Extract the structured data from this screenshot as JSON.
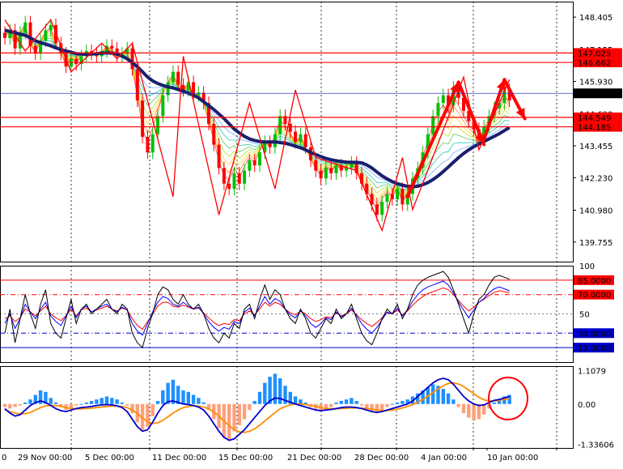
{
  "chart_data": {
    "type": "candlestick",
    "colors": {
      "bull": "#00c000",
      "bear": "#ff0000",
      "ma_main": "#1a1f6e",
      "resistance": "#ff0000",
      "current_line": "#2f3fc0",
      "osc_fast": "#000000",
      "osc_mid": "#0000ff",
      "osc_slow": "#ff0000",
      "hist_pos": "#1e90ff",
      "hist_neg": "#ffa07a",
      "macd_line": "#0000cd",
      "signal_line": "#ff8c00",
      "arrow": "#ff0000"
    },
    "x_axis": {
      "tick_labels": [
        "29 Nov 00:00",
        "5 Dec 00:00",
        "11 Dec 00:00",
        "15 Dec 00:00",
        "21 Dec 00:00",
        "28 Dec 00:00",
        "4 Jan 00:00",
        "10 Jan 00:00"
      ],
      "left_edge_label": "0"
    },
    "price_panel": {
      "ylim": [
        139.0,
        149.0
      ],
      "tick_labels": [
        "148.405",
        "147.155",
        "145.930",
        "144.690",
        "143.455",
        "142.230",
        "140.980",
        "139.755"
      ],
      "tick_values": [
        148.405,
        147.155,
        145.93,
        144.69,
        143.455,
        142.23,
        140.98,
        139.755
      ],
      "levels": [
        {
          "label": "147.025",
          "value": 147.025,
          "color": "#ff0000",
          "text_color": "#ffffff"
        },
        {
          "label": "146.662",
          "value": 146.662,
          "color": "#ff0000",
          "text_color": "#ffffff"
        },
        {
          "label": "144.549",
          "value": 144.549,
          "color": "#ff0000",
          "text_color": "#ffffff"
        },
        {
          "label": "144.185",
          "value": 144.185,
          "color": "#ff0000",
          "text_color": "#ffffff"
        }
      ],
      "current_price": {
        "label": "145.472",
        "value": 145.472
      },
      "close": [
        147.6,
        147.9,
        147.2,
        147.8,
        148.2,
        147.3,
        147.0,
        147.5,
        147.9,
        148.1,
        147.4,
        147.0,
        146.5,
        146.8,
        146.6,
        146.9,
        147.1,
        147.0,
        146.9,
        147.1,
        147.3,
        147.2,
        146.9,
        147.0,
        147.2,
        146.4,
        145.2,
        143.8,
        143.2,
        143.9,
        144.6,
        145.4,
        145.9,
        146.3,
        145.8,
        145.6,
        145.9,
        145.4,
        145.5,
        145.1,
        144.3,
        143.5,
        142.6,
        142.0,
        141.8,
        142.4,
        142.0,
        142.5,
        142.9,
        142.7,
        143.2,
        143.6,
        143.4,
        143.9,
        144.6,
        144.3,
        144.0,
        143.6,
        143.9,
        143.4,
        142.9,
        142.5,
        142.2,
        142.6,
        142.4,
        142.7,
        142.5,
        142.6,
        142.8,
        142.4,
        142.0,
        141.6,
        141.2,
        140.8,
        141.3,
        141.6,
        141.4,
        141.8,
        141.2,
        141.6,
        142.2,
        142.6,
        143.2,
        143.9,
        144.6,
        145.1,
        145.4,
        145.0,
        145.7,
        145.3,
        144.8,
        144.4,
        144.1,
        143.7,
        144.2,
        144.6,
        144.9,
        145.1,
        145.6,
        145.2
      ],
      "ma_main": [
        147.9,
        147.85,
        147.8,
        147.75,
        147.7,
        147.6,
        147.5,
        147.42,
        147.36,
        147.3,
        147.22,
        147.16,
        147.1,
        147.05,
        147.0,
        146.98,
        146.97,
        146.98,
        147.0,
        147.02,
        147.03,
        147.02,
        146.98,
        146.9,
        146.8,
        146.65,
        146.5,
        146.3,
        146.1,
        145.95,
        145.85,
        145.78,
        145.72,
        145.68,
        145.62,
        145.55,
        145.48,
        145.4,
        145.3,
        145.15,
        145.0,
        144.85,
        144.68,
        144.5,
        144.3,
        144.1,
        143.95,
        143.82,
        143.72,
        143.66,
        143.62,
        143.6,
        143.6,
        143.6,
        143.58,
        143.55,
        143.5,
        143.44,
        143.38,
        143.3,
        143.2,
        143.12,
        143.04,
        142.97,
        142.92,
        142.88,
        142.85,
        142.83,
        142.82,
        142.82,
        142.8,
        142.72,
        142.6,
        142.45,
        142.3,
        142.18,
        142.08,
        142.0,
        141.94,
        141.9,
        141.88,
        141.9,
        141.96,
        142.04,
        142.16,
        142.3,
        142.46,
        142.64,
        142.82,
        143.0,
        143.16,
        143.3,
        143.42,
        143.52,
        143.62,
        143.72,
        143.82,
        143.92,
        144.04,
        144.16
      ]
    },
    "zigzag": {
      "points": [
        [
          0,
          148.3
        ],
        [
          4,
          147.1
        ],
        [
          9,
          148.3
        ],
        [
          13,
          146.3
        ],
        [
          19,
          147.4
        ],
        [
          22,
          146.8
        ],
        [
          25,
          147.4
        ],
        [
          33,
          141.5
        ],
        [
          35,
          146.9
        ],
        [
          42,
          140.8
        ],
        [
          48,
          145.1
        ],
        [
          53,
          141.8
        ],
        [
          57,
          145.6
        ],
        [
          61,
          143.0
        ],
        [
          69,
          142.5
        ],
        [
          74,
          140.2
        ],
        [
          78,
          143.0
        ],
        [
          80,
          141.0
        ],
        [
          90,
          146.1
        ],
        [
          93,
          143.3
        ],
        [
          99,
          146.0
        ]
      ]
    },
    "oscillator_panel": {
      "ylim": [
        0,
        100
      ],
      "tick_labels": [
        "100",
        "50"
      ],
      "tick_values": [
        100,
        50
      ],
      "levels": [
        {
          "label": "85.0000",
          "value": 85,
          "color": "#ff0000",
          "style": "solid"
        },
        {
          "label": "70.0000",
          "value": 70,
          "color": "#ff0000",
          "style": "dashdot"
        },
        {
          "label": "30.0000",
          "value": 30,
          "color": "#0000cd",
          "style": "dashdot"
        },
        {
          "label": "15.0000",
          "value": 15,
          "color": "#0000cd",
          "style": "solid"
        }
      ],
      "fast": [
        30,
        55,
        20,
        45,
        70,
        50,
        35,
        60,
        75,
        40,
        30,
        25,
        45,
        65,
        40,
        55,
        60,
        50,
        55,
        60,
        65,
        55,
        50,
        60,
        55,
        30,
        20,
        15,
        35,
        50,
        70,
        78,
        75,
        65,
        60,
        70,
        60,
        55,
        60,
        50,
        35,
        25,
        20,
        30,
        25,
        40,
        35,
        55,
        60,
        45,
        65,
        80,
        65,
        75,
        70,
        55,
        45,
        40,
        55,
        45,
        30,
        25,
        35,
        45,
        40,
        55,
        45,
        50,
        60,
        45,
        30,
        22,
        18,
        30,
        45,
        55,
        50,
        60,
        45,
        55,
        70,
        80,
        85,
        88,
        90,
        92,
        94,
        88,
        75,
        60,
        45,
        30,
        50,
        65,
        70,
        80,
        88,
        90,
        88,
        86
      ],
      "mid": [
        40,
        50,
        35,
        45,
        60,
        52,
        45,
        55,
        62,
        48,
        42,
        38,
        48,
        58,
        46,
        55,
        58,
        52,
        55,
        58,
        60,
        55,
        52,
        57,
        54,
        40,
        32,
        28,
        40,
        52,
        62,
        68,
        66,
        60,
        58,
        62,
        58,
        55,
        57,
        50,
        42,
        36,
        32,
        36,
        34,
        42,
        40,
        52,
        56,
        48,
        58,
        68,
        60,
        66,
        63,
        55,
        49,
        46,
        53,
        48,
        40,
        36,
        40,
        46,
        44,
        52,
        47,
        50,
        56,
        48,
        40,
        34,
        30,
        36,
        44,
        52,
        50,
        56,
        48,
        54,
        63,
        70,
        75,
        78,
        80,
        82,
        84,
        80,
        72,
        62,
        54,
        46,
        54,
        62,
        66,
        72,
        76,
        78,
        76,
        74
      ],
      "slow": [
        45,
        48,
        42,
        46,
        55,
        52,
        48,
        53,
        58,
        50,
        46,
        43,
        48,
        55,
        48,
        54,
        56,
        52,
        54,
        56,
        58,
        55,
        53,
        56,
        54,
        45,
        38,
        34,
        42,
        50,
        58,
        62,
        62,
        58,
        57,
        59,
        57,
        55,
        56,
        51,
        46,
        41,
        38,
        40,
        39,
        44,
        43,
        50,
        53,
        49,
        55,
        62,
        58,
        62,
        60,
        55,
        51,
        49,
        53,
        50,
        45,
        42,
        44,
        47,
        46,
        51,
        48,
        50,
        54,
        49,
        44,
        40,
        37,
        41,
        46,
        51,
        50,
        54,
        49,
        53,
        59,
        64,
        68,
        71,
        73,
        75,
        77,
        75,
        70,
        64,
        58,
        53,
        57,
        62,
        65,
        69,
        72,
        74,
        73,
        72
      ]
    },
    "macd_panel": {
      "ylim": [
        -1.45,
        1.25
      ],
      "tick_labels": [
        "1.1079",
        "0.00",
        "-1.33606"
      ],
      "tick_values": [
        1.1079,
        0.0,
        -1.33606
      ],
      "histogram": [
        -0.1,
        -0.15,
        -0.1,
        -0.05,
        0.05,
        0.15,
        0.3,
        0.45,
        0.4,
        0.2,
        0.05,
        -0.1,
        -0.2,
        -0.15,
        -0.05,
        0.0,
        0.05,
        0.1,
        0.15,
        0.2,
        0.25,
        0.2,
        0.15,
        0.05,
        -0.05,
        -0.3,
        -0.6,
        -0.85,
        -0.75,
        -0.4,
        0.1,
        0.45,
        0.7,
        0.8,
        0.6,
        0.45,
        0.4,
        0.3,
        0.2,
        0.05,
        -0.2,
        -0.5,
        -0.8,
        -1.1,
        -1.2,
        -0.9,
        -0.7,
        -0.5,
        -0.2,
        0.1,
        0.4,
        0.7,
        0.9,
        1.0,
        0.85,
        0.6,
        0.4,
        0.25,
        0.15,
        0.05,
        -0.1,
        -0.2,
        -0.25,
        -0.15,
        -0.1,
        0.05,
        0.1,
        0.15,
        0.2,
        0.1,
        -0.05,
        -0.15,
        -0.25,
        -0.3,
        -0.2,
        -0.1,
        0.0,
        0.05,
        0.1,
        0.15,
        0.25,
        0.35,
        0.45,
        0.55,
        0.65,
        0.6,
        0.5,
        0.35,
        0.15,
        -0.1,
        -0.3,
        -0.45,
        -0.55,
        -0.5,
        -0.35,
        -0.15,
        0.05,
        0.15,
        0.25,
        0.3
      ],
      "macd": [
        -0.15,
        -0.3,
        -0.4,
        -0.35,
        -0.2,
        -0.05,
        0.05,
        0.1,
        0.05,
        -0.05,
        -0.15,
        -0.22,
        -0.25,
        -0.2,
        -0.15,
        -0.12,
        -0.1,
        -0.08,
        -0.05,
        -0.03,
        -0.02,
        -0.03,
        -0.06,
        -0.12,
        -0.25,
        -0.5,
        -0.75,
        -0.9,
        -0.85,
        -0.6,
        -0.3,
        -0.05,
        0.08,
        0.1,
        0.05,
        0.0,
        -0.02,
        -0.05,
        -0.1,
        -0.2,
        -0.4,
        -0.65,
        -0.9,
        -1.1,
        -1.2,
        -1.15,
        -1.0,
        -0.85,
        -0.65,
        -0.45,
        -0.25,
        -0.05,
        0.1,
        0.2,
        0.18,
        0.12,
        0.06,
        0.0,
        -0.05,
        -0.1,
        -0.15,
        -0.2,
        -0.22,
        -0.2,
        -0.18,
        -0.15,
        -0.12,
        -0.1,
        -0.1,
        -0.12,
        -0.15,
        -0.2,
        -0.25,
        -0.28,
        -0.25,
        -0.2,
        -0.15,
        -0.1,
        -0.05,
        0.0,
        0.1,
        0.25,
        0.4,
        0.55,
        0.7,
        0.8,
        0.85,
        0.8,
        0.65,
        0.45,
        0.25,
        0.1,
        0.0,
        -0.05,
        -0.03,
        0.05,
        0.12,
        0.15,
        0.2,
        0.25
      ],
      "signal": [
        -0.2,
        -0.25,
        -0.3,
        -0.33,
        -0.32,
        -0.28,
        -0.2,
        -0.12,
        -0.06,
        -0.04,
        -0.05,
        -0.08,
        -0.12,
        -0.15,
        -0.16,
        -0.16,
        -0.15,
        -0.14,
        -0.12,
        -0.1,
        -0.08,
        -0.07,
        -0.07,
        -0.08,
        -0.12,
        -0.2,
        -0.32,
        -0.46,
        -0.58,
        -0.64,
        -0.62,
        -0.54,
        -0.42,
        -0.3,
        -0.2,
        -0.12,
        -0.08,
        -0.06,
        -0.07,
        -0.1,
        -0.16,
        -0.26,
        -0.4,
        -0.56,
        -0.72,
        -0.84,
        -0.92,
        -0.94,
        -0.9,
        -0.82,
        -0.7,
        -0.56,
        -0.42,
        -0.28,
        -0.16,
        -0.08,
        -0.03,
        0.0,
        0.0,
        -0.02,
        -0.05,
        -0.08,
        -0.12,
        -0.15,
        -0.16,
        -0.16,
        -0.15,
        -0.14,
        -0.13,
        -0.13,
        -0.14,
        -0.15,
        -0.17,
        -0.2,
        -0.22,
        -0.22,
        -0.2,
        -0.17,
        -0.13,
        -0.08,
        -0.02,
        0.06,
        0.15,
        0.26,
        0.38,
        0.5,
        0.6,
        0.68,
        0.7,
        0.66,
        0.58,
        0.46,
        0.34,
        0.22,
        0.14,
        0.1,
        0.1,
        0.12,
        0.15,
        0.18
      ]
    }
  }
}
